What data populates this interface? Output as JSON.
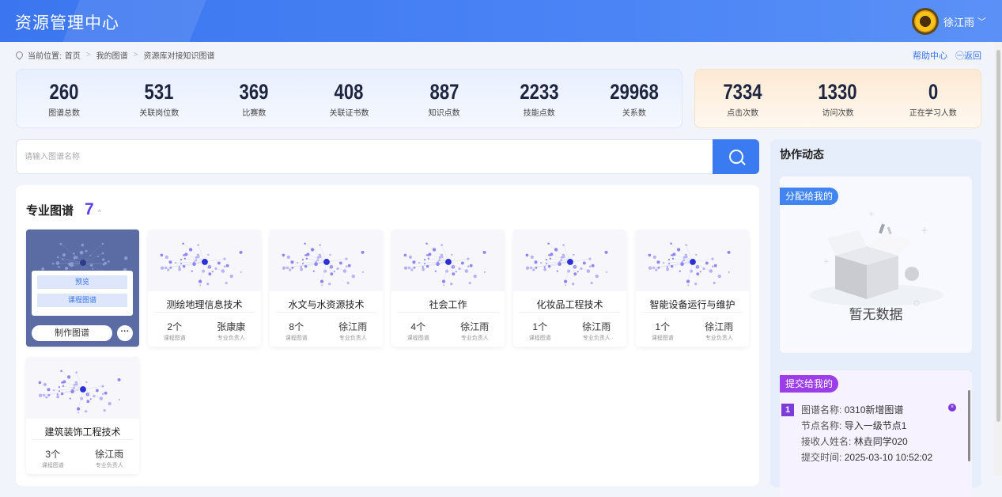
{
  "header": {
    "title": "资源管理中心",
    "user_name": "徐江雨"
  },
  "breadcrumb": {
    "prefix": "当前位置:",
    "home": "首页",
    "level2": "我的图谱",
    "current": "资源库对接知识图谱"
  },
  "links": {
    "help": "帮助中心",
    "back": "返回"
  },
  "stats_a": [
    {
      "value": "260",
      "label": "图谱总数"
    },
    {
      "value": "531",
      "label": "关联岗位数"
    },
    {
      "value": "369",
      "label": "比赛数"
    },
    {
      "value": "408",
      "label": "关联证书数"
    },
    {
      "value": "887",
      "label": "知识点数"
    },
    {
      "value": "2233",
      "label": "技能点数"
    },
    {
      "value": "29968",
      "label": "关系数"
    }
  ],
  "stats_b": [
    {
      "value": "7334",
      "label": "点击次数"
    },
    {
      "value": "1330",
      "label": "访问次数"
    },
    {
      "value": "0",
      "label": "正在学习人数"
    }
  ],
  "search": {
    "placeholder": "请输入图谱名称"
  },
  "section": {
    "title": "专业图谱",
    "count": "7",
    "toggle": "^"
  },
  "active_card": {
    "preview": "预览",
    "course_graph": "课程图谱",
    "make": "制作图谱",
    "more": "···"
  },
  "cards": [
    {
      "name": "测绘地理信息技术",
      "count": "2个",
      "count_label": "课程图谱",
      "owner": "张康康",
      "owner_label": "专业负责人"
    },
    {
      "name": "水文与水资源技术",
      "count": "8个",
      "count_label": "课程图谱",
      "owner": "徐江雨",
      "owner_label": "专业负责人"
    },
    {
      "name": "社会工作",
      "count": "4个",
      "count_label": "课程图谱",
      "owner": "徐江雨",
      "owner_label": "专业负责人"
    },
    {
      "name": "化妆品工程技术",
      "count": "1个",
      "count_label": "课程图谱",
      "owner": "徐江雨",
      "owner_label": "专业负责人"
    },
    {
      "name": "智能设备运行与维护",
      "count": "1个",
      "count_label": "课程图谱",
      "owner": "徐江雨",
      "owner_label": "专业负责人"
    },
    {
      "name": "建筑装饰工程技术",
      "count": "3个",
      "count_label": "课程图谱",
      "owner": "徐江雨",
      "owner_label": "专业负责人"
    }
  ],
  "side": {
    "title": "协作动态",
    "assigned_tag": "分配给我的",
    "empty_text": "暂无数据",
    "submitted_tag": "提交给我的",
    "item": {
      "index": "1",
      "graph_k": "图谱名称:",
      "graph_v": "0310新增图谱",
      "node_k": "节点名称:",
      "node_v": "导入一级节点1",
      "recv_k": "接收人姓名:",
      "recv_v": "林垚同学020",
      "time_k": "提交时间:",
      "time_v": "2025-03-10 10:52:02",
      "close": "×"
    }
  },
  "colors": {
    "primary": "#3b76f0",
    "purple": "#7d3bd8",
    "count": "#5b3df0"
  }
}
